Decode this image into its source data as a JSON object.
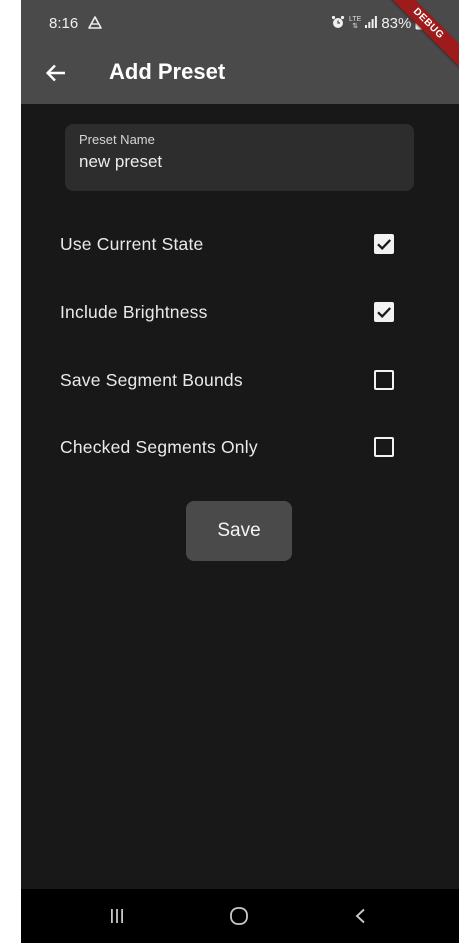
{
  "status_bar": {
    "time": "8:16",
    "network": "LTE",
    "battery": "83%",
    "debug_banner": "DEBUG"
  },
  "app_bar": {
    "title": "Add Preset",
    "back_icon": "arrow-back-icon"
  },
  "form": {
    "preset_name_label": "Preset Name",
    "preset_name_value": "new preset",
    "options": [
      {
        "label": "Use Current State",
        "checked": true
      },
      {
        "label": "Include Brightness",
        "checked": true
      },
      {
        "label": "Save Segment Bounds",
        "checked": false
      },
      {
        "label": "Checked Segments Only",
        "checked": false
      }
    ],
    "save_label": "Save"
  },
  "nav_bar": {
    "icons": [
      "recent-apps-icon",
      "home-icon",
      "back-icon"
    ]
  },
  "colors": {
    "background": "#181818",
    "header": "#4a4a4a",
    "field": "#2d2d2d",
    "debug_ribbon": "#9e1b1b"
  }
}
